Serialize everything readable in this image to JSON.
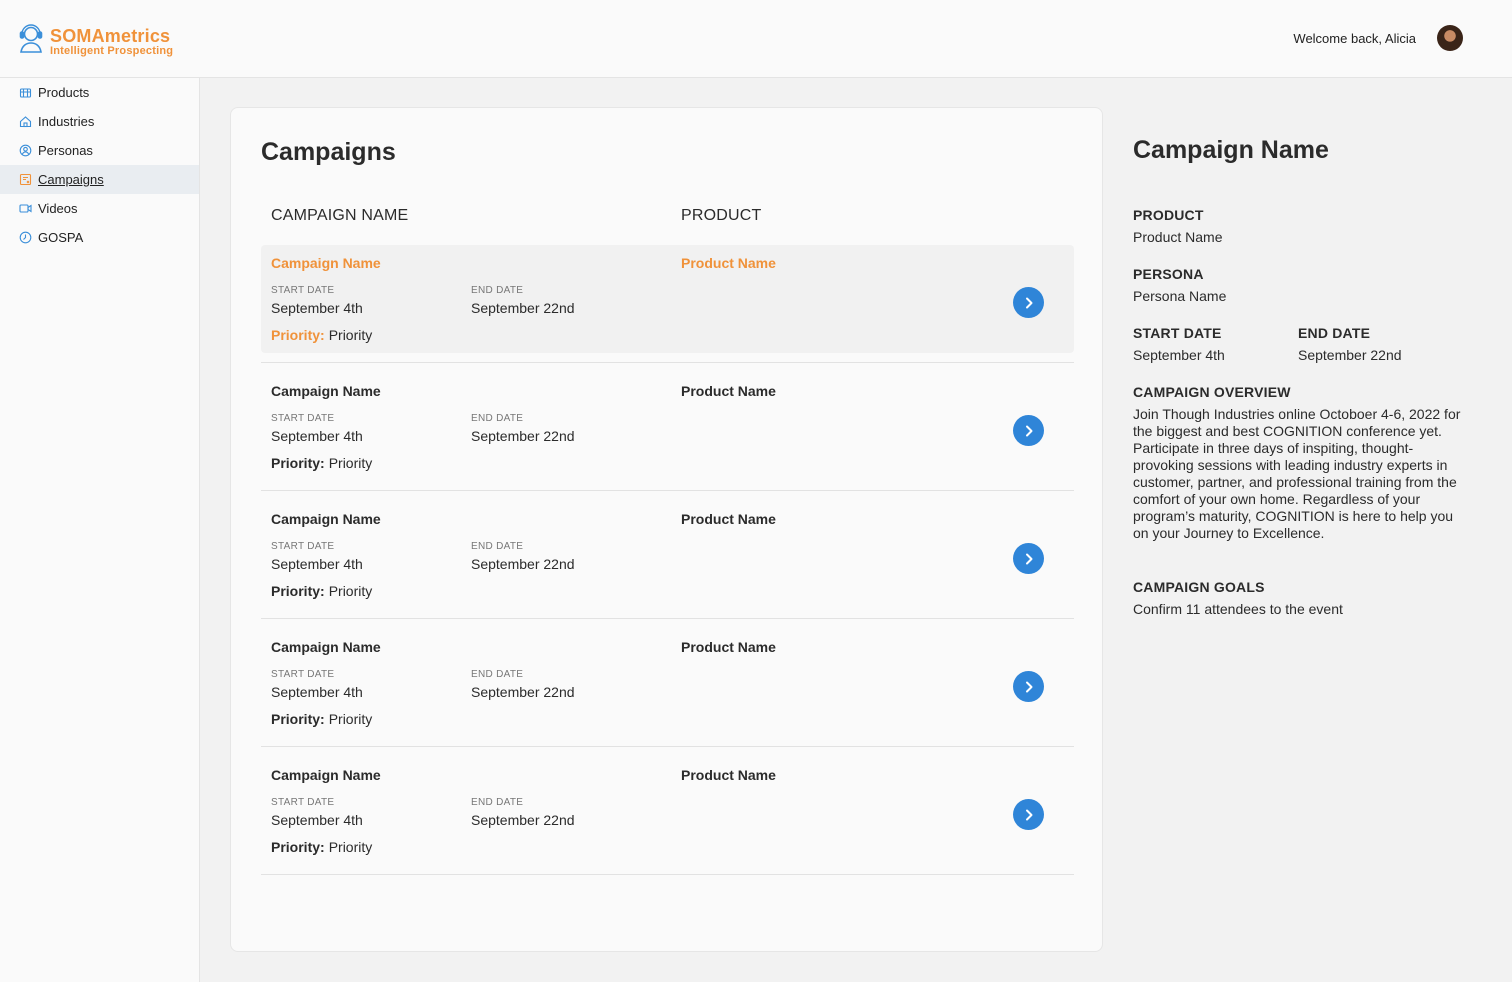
{
  "header": {
    "brand": "SOMAmetrics",
    "tagline": "Intelligent Prospecting",
    "welcome": "Welcome back, Alicia"
  },
  "sidebar": {
    "items": [
      {
        "label": "Products",
        "icon": "box-icon"
      },
      {
        "label": "Industries",
        "icon": "home-icon"
      },
      {
        "label": "Personas",
        "icon": "user-circle-icon"
      },
      {
        "label": "Campaigns",
        "icon": "campaign-icon",
        "active": true
      },
      {
        "label": "Videos",
        "icon": "video-icon"
      },
      {
        "label": "GOSPA",
        "icon": "clock-icon"
      }
    ]
  },
  "campaigns": {
    "title": "Campaigns",
    "columns": {
      "name": "CAMPAIGN NAME",
      "product": "PRODUCT"
    },
    "labels": {
      "start": "START DATE",
      "end": "END DATE",
      "priority": "Priority:"
    },
    "rows": [
      {
        "name": "Campaign Name",
        "product": "Product Name",
        "start": "September 4th",
        "end": "September 22nd",
        "priority": "Priority",
        "selected": true
      },
      {
        "name": "Campaign Name",
        "product": "Product Name",
        "start": "September 4th",
        "end": "September 22nd",
        "priority": "Priority"
      },
      {
        "name": "Campaign Name",
        "product": "Product Name",
        "start": "September 4th",
        "end": "September 22nd",
        "priority": "Priority"
      },
      {
        "name": "Campaign Name",
        "product": "Product Name",
        "start": "September 4th",
        "end": "September 22nd",
        "priority": "Priority"
      },
      {
        "name": "Campaign Name",
        "product": "Product Name",
        "start": "September 4th",
        "end": "September 22nd",
        "priority": "Priority"
      }
    ]
  },
  "detail": {
    "title": "Campaign Name",
    "product_label": "PRODUCT",
    "product": "Product Name",
    "persona_label": "PERSONA",
    "persona": "Persona Name",
    "start_label": "START DATE",
    "start": "September 4th",
    "end_label": "END DATE",
    "end": "September 22nd",
    "overview_label": "CAMPAIGN OVERVIEW",
    "overview": "Join Though Industries online Octoboer 4-6, 2022 for the biggest and best COGNITION conference yet. Participate in three days of inspiting, thought-provoking sessions with leading industry experts in customer, partner, and professional training from the comfort of your own home. Regardless of your program’s maturity, COGNITION is here to help you on your Journey to Excellence.",
    "goals_label": "CAMPAIGN GOALS",
    "goals": "Confirm 11 attendees to the event"
  },
  "colors": {
    "accent": "#f0923a",
    "button": "#2f85d8",
    "selected_row": "#f1f1f1",
    "active_nav": "#e9edf1"
  }
}
